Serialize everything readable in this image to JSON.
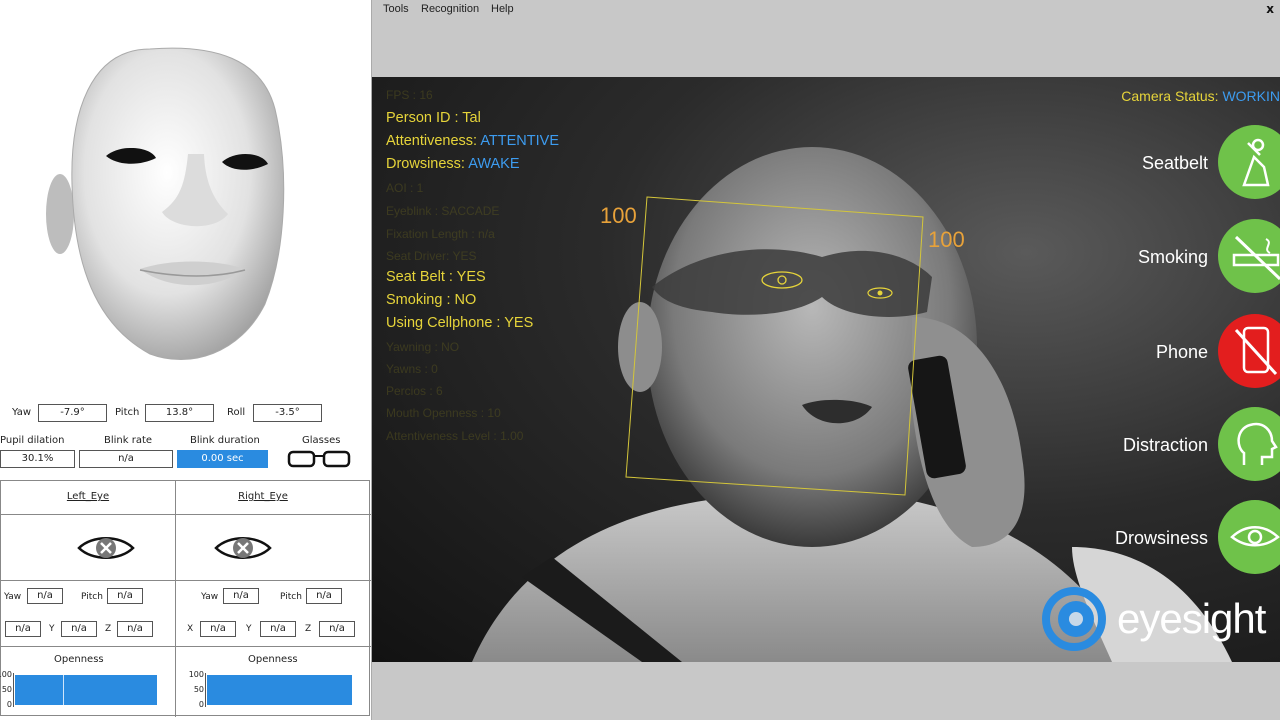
{
  "menu": {
    "items": [
      "Tools",
      "Recognition",
      "Help"
    ],
    "close": "x"
  },
  "head_pose": {
    "yaw_label": "Yaw",
    "yaw_value": "-7.9°",
    "pitch_label": "Pitch",
    "pitch_value": "13.8°",
    "roll_label": "Roll",
    "roll_value": "-3.5°"
  },
  "metrics": {
    "pupil_label": "Pupil dilation",
    "pupil_value": "30.1%",
    "blink_rate_label": "Blink rate",
    "blink_rate_value": "n/a",
    "blink_duration_label": "Blink duration",
    "blink_duration_value": "0.00 sec",
    "glasses_label": "Glasses"
  },
  "left_eye": {
    "title": "Left_Eye",
    "yaw_label": "Yaw",
    "yaw": "n/a",
    "pitch_label": "Pitch",
    "pitch": "n/a",
    "y_label": "Y",
    "y": "n/a",
    "z_label": "Z",
    "x": "n/a",
    "yv": "n/a",
    "z": "n/a",
    "openness_label": "Openness",
    "openness": 100
  },
  "right_eye": {
    "title": "Right_Eye",
    "yaw_label": "Yaw",
    "yaw": "n/a",
    "pitch_label": "Pitch",
    "pitch": "n/a",
    "x_label": "X",
    "y_label": "Y",
    "z_label": "Z",
    "x": "n/a",
    "y": "n/a",
    "z": "n/a",
    "openness_label": "Openness",
    "openness": 100
  },
  "axis": {
    "top": "100",
    "mid": "50",
    "bottom": "0"
  },
  "overlay": {
    "person_label": "Person ID : ",
    "person_value": "Tal",
    "attentiveness_label": "Attentiveness:",
    "attentiveness_value": "ATTENTIVE",
    "drowsiness_label": "Drowsiness:",
    "drowsiness_value": "AWAKE",
    "seatbelt": "Seat Belt : YES",
    "smoking": "Smoking : NO",
    "cellphone": "Using Cellphone : YES"
  },
  "camera": {
    "label": "Camera Status:",
    "value": "WORKIN"
  },
  "face_box": {
    "left_score": "100",
    "right_score": "100"
  },
  "status": [
    {
      "label": "Seatbelt",
      "icon": "seatbelt-icon",
      "color": "#6fc24a"
    },
    {
      "label": "Smoking",
      "icon": "no-smoking-icon",
      "color": "#6fc24a"
    },
    {
      "label": "Phone",
      "icon": "no-phone-icon",
      "color": "#e31e1e"
    },
    {
      "label": "Distraction",
      "icon": "head-icon",
      "color": "#6fc24a"
    },
    {
      "label": "Drowsiness",
      "icon": "eye-icon",
      "color": "#6fc24a"
    }
  ],
  "brand": "eyesight"
}
